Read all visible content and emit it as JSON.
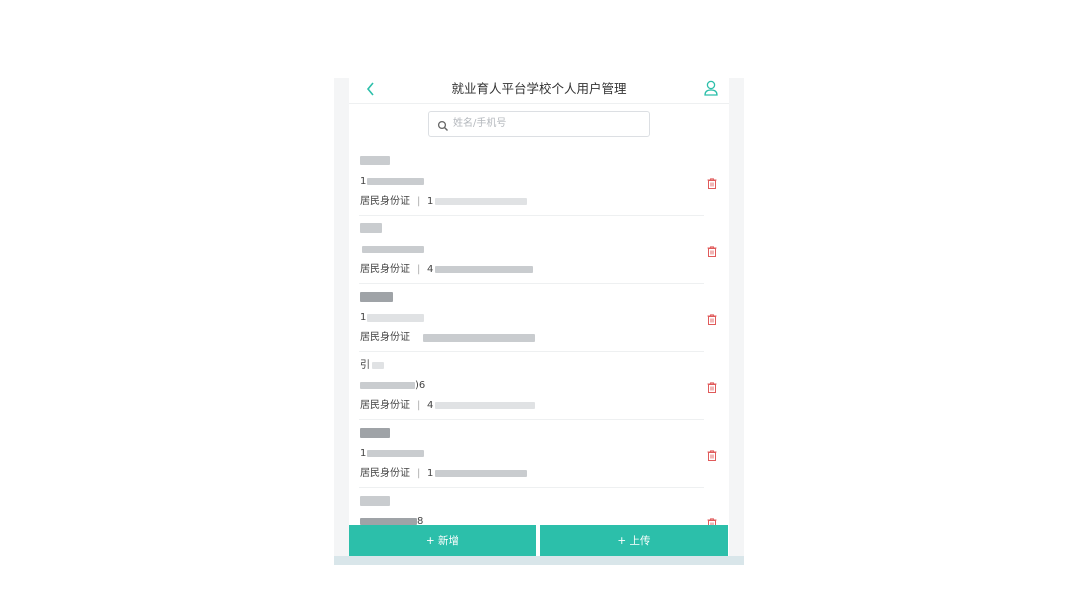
{
  "header": {
    "title": "就业育人平台学校个人用户管理",
    "back_icon": "chevron-left-icon",
    "user_icon": "user-icon"
  },
  "search": {
    "placeholder": "姓名/手机号",
    "icon": "search-icon"
  },
  "list": {
    "items": [
      {
        "phone_prefix": "1",
        "phone_suffix": "",
        "id_type": "居民身份证",
        "id_prefix": "1",
        "name_char": ""
      },
      {
        "phone_prefix": "",
        "phone_suffix": "",
        "id_type": "居民身份证",
        "id_prefix": "4",
        "name_char": ""
      },
      {
        "phone_prefix": "1",
        "phone_suffix": "",
        "id_type": "居民身份证",
        "id_prefix": "",
        "name_char": ""
      },
      {
        "phone_prefix": "",
        "phone_suffix": ")6",
        "id_type": "居民身份证",
        "id_prefix": "4",
        "name_char": "引"
      },
      {
        "phone_prefix": "1",
        "phone_suffix": "",
        "id_type": "居民身份证",
        "id_prefix": "1",
        "name_char": ""
      },
      {
        "phone_prefix": "",
        "phone_suffix": "8",
        "id_type": "",
        "id_prefix": "",
        "name_char": ""
      }
    ],
    "id_separator": "|",
    "delete_icon": "trash-icon"
  },
  "buttons": {
    "add": "+ 新增",
    "upload": "+ 上传"
  },
  "colors": {
    "accent": "#2cbfaa",
    "delete": "#e05a5a",
    "title_text": "#333333"
  }
}
